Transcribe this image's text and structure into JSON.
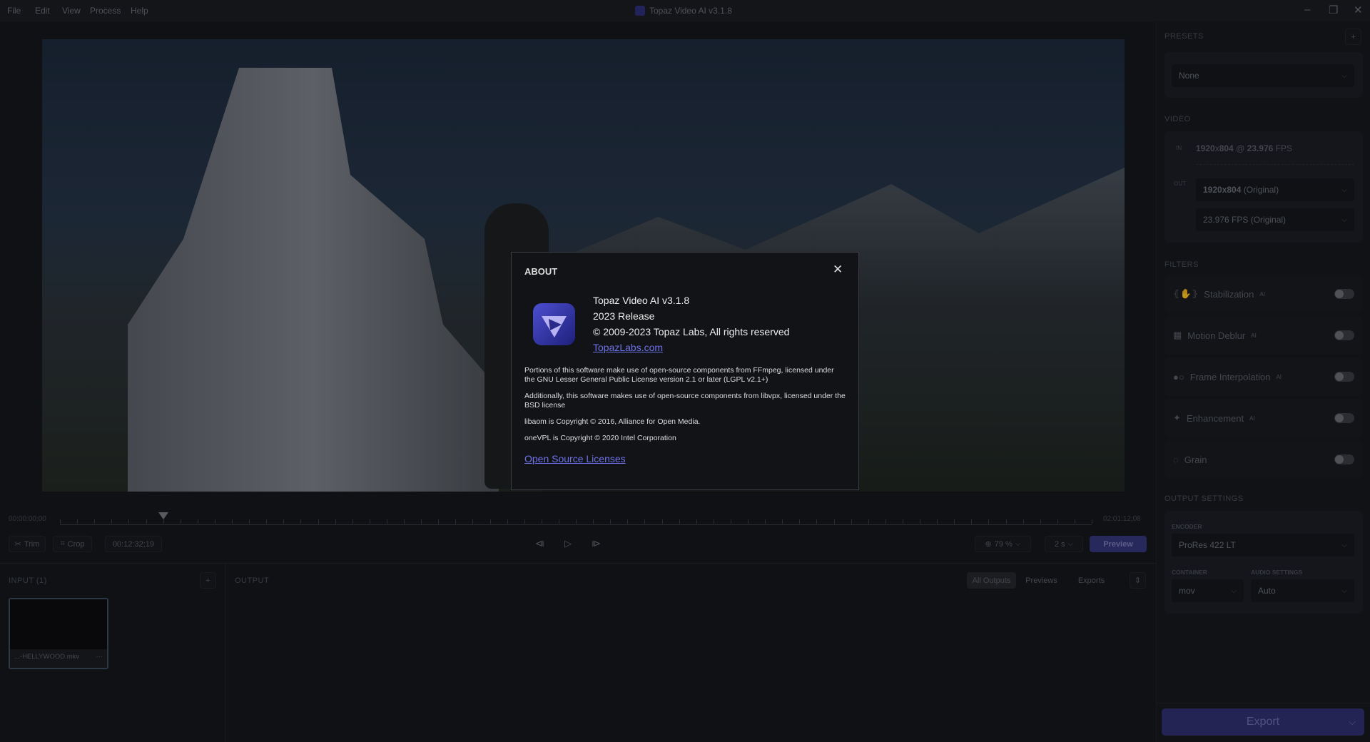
{
  "menu": [
    "File",
    "Edit",
    "View",
    "Process",
    "Help"
  ],
  "window_title": "Topaz Video AI  v3.1.8",
  "presets": {
    "label": "PRESETS",
    "add": "+",
    "value": "None"
  },
  "video": {
    "label": "VIDEO",
    "in_tag": "IN",
    "in_res": "1920",
    "in_x": "x",
    "in_res2": "804",
    "in_at": " @ ",
    "in_fps": "23.976",
    "in_fps_unit": " FPS",
    "out_tag": "OUT",
    "out_res": "1920x804",
    "out_res_note": " (Original)",
    "out_fps": "23.976 FPS (Original)"
  },
  "filters": {
    "label": "FILTERS",
    "items": [
      {
        "name": "Stabilization",
        "ai": "AI"
      },
      {
        "name": "Motion Deblur",
        "ai": "AI"
      },
      {
        "name": "Frame Interpolation",
        "ai": "AI"
      },
      {
        "name": "Enhancement",
        "ai": "AI"
      },
      {
        "name": "Grain",
        "ai": ""
      }
    ]
  },
  "output_settings": {
    "label": "OUTPUT SETTINGS",
    "encoder_label": "ENCODER",
    "encoder": "ProRes 422 LT",
    "container_label": "CONTAINER",
    "container": "mov",
    "audio_label": "AUDIO SETTINGS",
    "audio": "Auto"
  },
  "export": "Export",
  "timeline": {
    "start": "00:00:00;00",
    "end": "02:01:12;08",
    "position": 0.1
  },
  "controls": {
    "trim": "Trim",
    "crop": "Crop",
    "timecode": "00:12:32;19",
    "zoom": "79 %",
    "duration": "2 s",
    "preview": "Preview"
  },
  "input": {
    "label": "INPUT (1)",
    "add": "+",
    "file": "...-HELLYWOOD.mkv",
    "more": "···"
  },
  "output": {
    "label": "OUTPUT",
    "tabs": [
      "All Outputs",
      "Previews",
      "Exports"
    ]
  },
  "about": {
    "title": "ABOUT",
    "product": "Topaz Video AI  v3.1.8",
    "release": "2023 Release",
    "copyright": "© 2009-2023 Topaz Labs, All rights reserved",
    "link": "TopazLabs.com",
    "p1": "Portions of this software make use of open-source components from FFmpeg, licensed under the GNU Lesser General Public License version 2.1 or later (LGPL v2.1+)",
    "p2": "Additionally, this software makes use of open-source components from libvpx, licensed under the BSD license",
    "p3": "libaom is Copyright © 2016, Alliance for Open Media.",
    "p4": "oneVPL is Copyright © 2020 Intel Corporation",
    "licenses": "Open Source Licenses"
  }
}
